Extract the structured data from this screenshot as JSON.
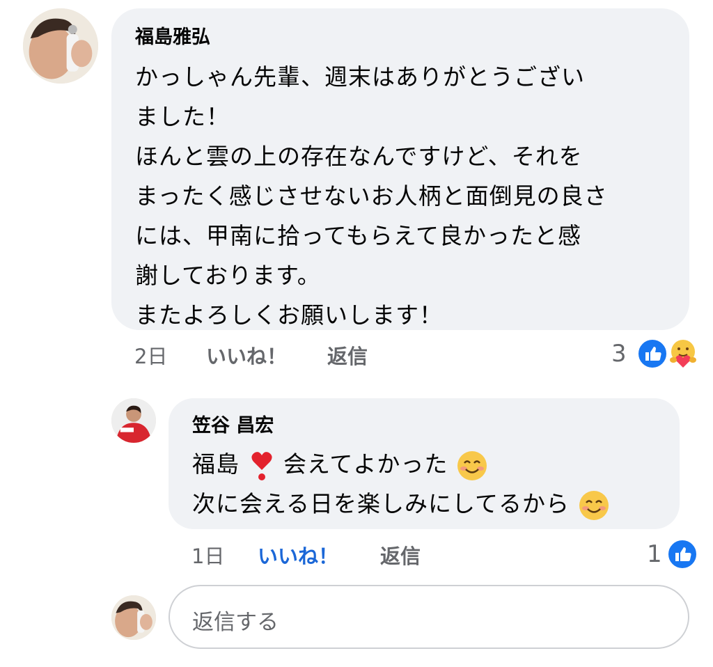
{
  "comment": {
    "author": "福島雅弘",
    "lines": [
      "かっしゃん先輩、週末はありがとうござい",
      "ました！",
      "ほんと雲の上の存在なんですけど、それを",
      "まったく感じさせないお人柄と面倒見の良さ",
      "には、甲南に拾ってもらえて良かったと感",
      "謝しております。",
      "またよろしくお願いします！"
    ],
    "time": "2日",
    "like_label": "いいね！",
    "reply_label": "返信",
    "reaction_count": "3",
    "reactions": [
      "like-icon",
      "care-icon"
    ]
  },
  "reply": {
    "author": "笠谷 昌宏",
    "line1": {
      "before": "福島",
      "heart": "❣️",
      "after": "会えてよかった"
    },
    "line2": "次に会える日を楽しみにしてるから",
    "time": "1日",
    "like_label": "いいね！",
    "reply_label": "返信",
    "reaction_count": "1",
    "liked": true,
    "colors": {
      "liked": "#1b67d7"
    }
  },
  "reply_input": {
    "placeholder": "返信する"
  },
  "colors": {
    "bubble": "#f0f2f5",
    "meta": "#65676b",
    "like_blue": "#1877f2"
  }
}
